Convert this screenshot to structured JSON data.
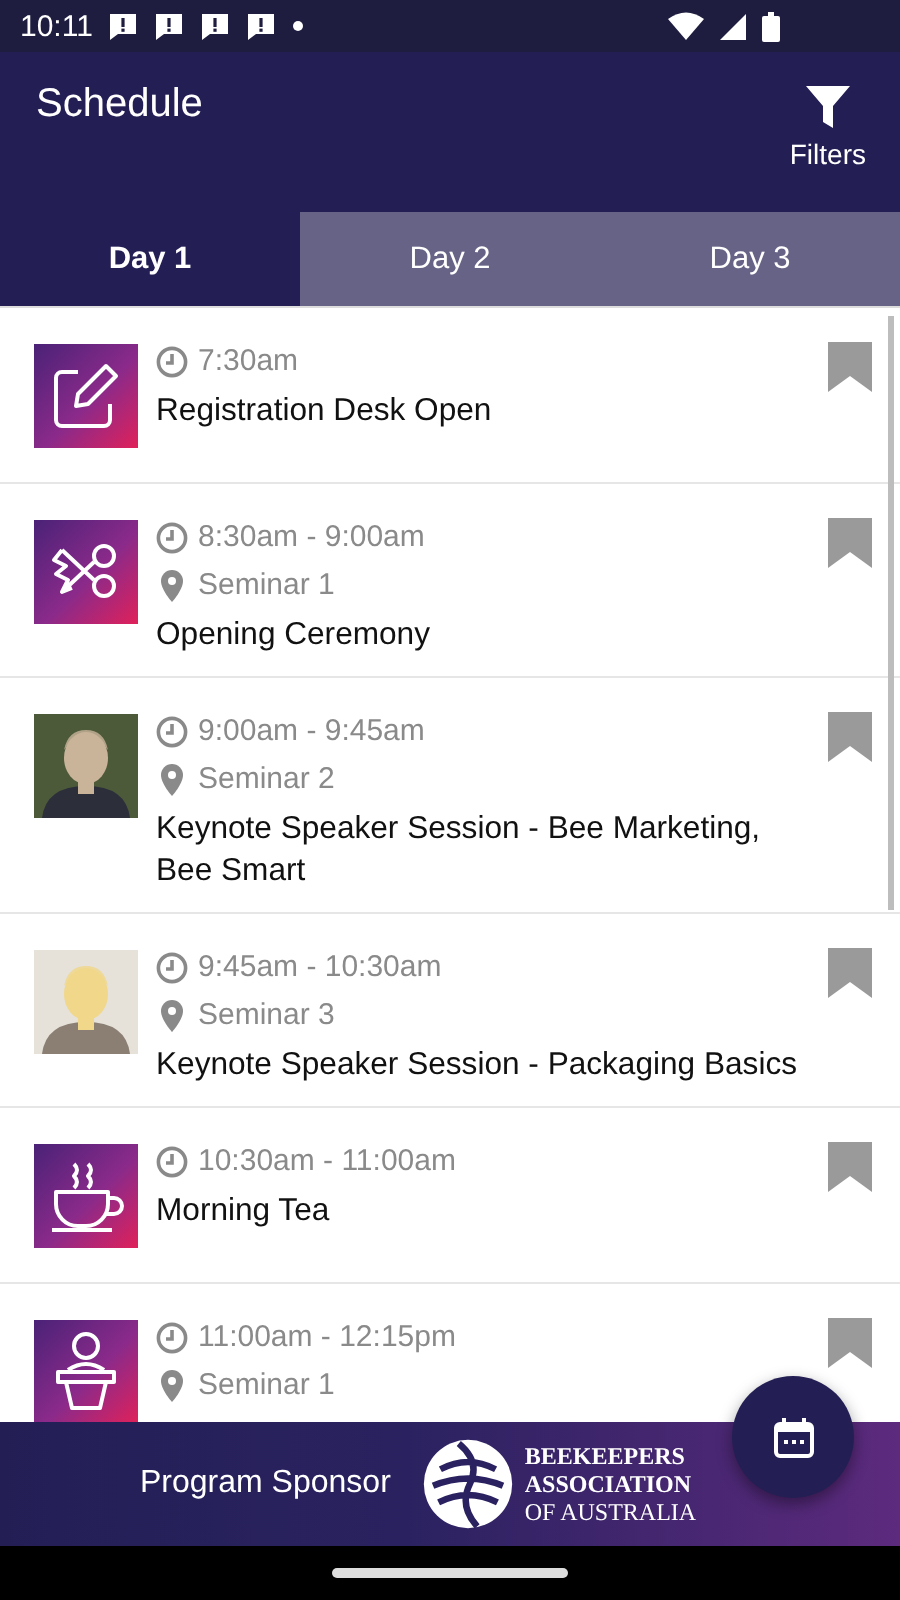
{
  "status_bar": {
    "time": "10:11"
  },
  "app_bar": {
    "title": "Schedule",
    "filters_label": "Filters"
  },
  "tabs": [
    {
      "label": "Day 1",
      "selected": true
    },
    {
      "label": "Day 2",
      "selected": false
    },
    {
      "label": "Day 3",
      "selected": false
    }
  ],
  "sessions": [
    {
      "kind": "pencil",
      "time": "7:30am",
      "title": "Registration Desk Open"
    },
    {
      "kind": "ribbon",
      "time": "8:30am - 9:00am",
      "location": "Seminar 1",
      "title": "Opening Ceremony"
    },
    {
      "kind": "picture",
      "time": "9:00am - 9:45am",
      "location": "Seminar 2",
      "title": "Keynote Speaker Session - Bee Marketing, Bee Smart"
    },
    {
      "kind": "picture",
      "time": "9:45am - 10:30am",
      "location": "Seminar 3",
      "title": "Keynote Speaker Session - Packaging Basics"
    },
    {
      "kind": "cup",
      "time": "10:30am - 11:00am",
      "title": "Morning Tea"
    },
    {
      "kind": "podium",
      "time": "11:00am - 12:15pm",
      "location": "Seminar 1"
    }
  ],
  "sponsor_banner": {
    "label": "Program Sponsor",
    "logo_lines": [
      "BEEKEEPERS",
      "ASSOCIATION",
      "OF AUSTRALIA"
    ]
  }
}
